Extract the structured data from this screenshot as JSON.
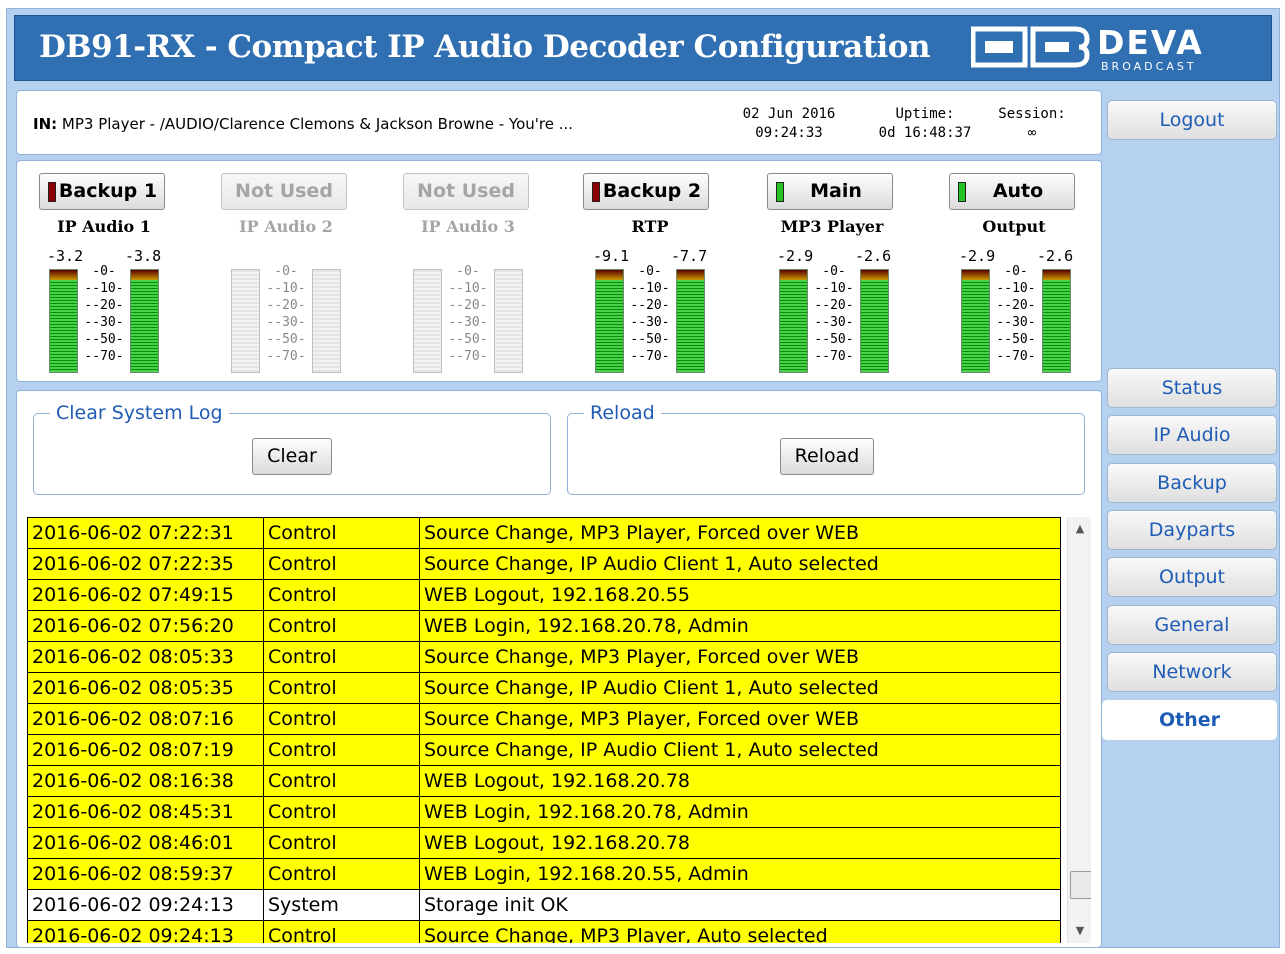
{
  "header": {
    "title": "DB91-RX - Compact IP Audio Decoder Configuration",
    "logo_text": "DEVA",
    "logo_sub": "BROADCAST"
  },
  "info": {
    "in_label": "IN:",
    "in_value": "MP3 Player - /AUDIO/Clarence Clemons & Jackson Browne - You're ...",
    "date": "02 Jun 2016",
    "time": "09:24:33",
    "uptime_label": "Uptime:",
    "uptime_value": "0d 16:48:37",
    "session_label": "Session:",
    "session_value": "∞"
  },
  "sidebar": {
    "logout": "Logout",
    "items": [
      "Status",
      "IP Audio",
      "Backup",
      "Dayparts",
      "Output",
      "General",
      "Network",
      "Other"
    ],
    "active": "Other"
  },
  "sources": [
    {
      "button": "Backup 1",
      "led": "red",
      "label": "IP Audio 1",
      "enabled": true,
      "peak_l": "-3.2",
      "peak_r": "-3.8"
    },
    {
      "button": "Not Used",
      "led": "none",
      "label": "IP Audio 2",
      "enabled": false,
      "peak_l": "",
      "peak_r": ""
    },
    {
      "button": "Not Used",
      "led": "none",
      "label": "IP Audio 3",
      "enabled": false,
      "peak_l": "",
      "peak_r": ""
    },
    {
      "button": "Backup 2",
      "led": "red",
      "label": "RTP",
      "enabled": true,
      "peak_l": "-9.1",
      "peak_r": "-7.7"
    },
    {
      "button": "Main",
      "led": "green",
      "label": "MP3 Player",
      "enabled": true,
      "peak_l": "-2.9",
      "peak_r": "-2.6"
    },
    {
      "button": "Auto",
      "led": "green",
      "label": "Output",
      "enabled": true,
      "peak_l": "-2.9",
      "peak_r": "-2.6"
    }
  ],
  "meter_scale": [
    "0",
    "-10",
    "-20",
    "-30",
    "-50",
    "-70"
  ],
  "clear_log": {
    "legend": "Clear System Log",
    "button": "Clear"
  },
  "reload": {
    "legend": "Reload",
    "button": "Reload"
  },
  "log": [
    {
      "time": "2016-06-02 07:22:31",
      "type": "Control",
      "msg": "Source Change, MP3 Player, Forced over WEB"
    },
    {
      "time": "2016-06-02 07:22:35",
      "type": "Control",
      "msg": "Source Change, IP Audio Client 1, Auto selected"
    },
    {
      "time": "2016-06-02 07:49:15",
      "type": "Control",
      "msg": "WEB Logout, 192.168.20.55"
    },
    {
      "time": "2016-06-02 07:56:20",
      "type": "Control",
      "msg": "WEB Login, 192.168.20.78, Admin"
    },
    {
      "time": "2016-06-02 08:05:33",
      "type": "Control",
      "msg": "Source Change, MP3 Player, Forced over WEB"
    },
    {
      "time": "2016-06-02 08:05:35",
      "type": "Control",
      "msg": "Source Change, IP Audio Client 1, Auto selected"
    },
    {
      "time": "2016-06-02 08:07:16",
      "type": "Control",
      "msg": "Source Change, MP3 Player, Forced over WEB"
    },
    {
      "time": "2016-06-02 08:07:19",
      "type": "Control",
      "msg": "Source Change, IP Audio Client 1, Auto selected"
    },
    {
      "time": "2016-06-02 08:16:38",
      "type": "Control",
      "msg": "WEB Logout, 192.168.20.78"
    },
    {
      "time": "2016-06-02 08:45:31",
      "type": "Control",
      "msg": "WEB Login, 192.168.20.78, Admin"
    },
    {
      "time": "2016-06-02 08:46:01",
      "type": "Control",
      "msg": "WEB Logout, 192.168.20.78"
    },
    {
      "time": "2016-06-02 08:59:37",
      "type": "Control",
      "msg": "WEB Login, 192.168.20.55, Admin"
    },
    {
      "time": "2016-06-02 09:24:13",
      "type": "System",
      "msg": "Storage init OK"
    },
    {
      "time": "2016-06-02 09:24:13",
      "type": "Control",
      "msg": "Source Change, MP3 Player, Auto selected"
    }
  ],
  "colors": {
    "header_bg": "#2f6fb2",
    "frame_bg": "#b5d1ef",
    "accent_text": "#1f5cb5",
    "log_control_bg": "#ffff00",
    "log_system_bg": "#ffffff",
    "led_red": "#8b0000",
    "led_green": "#22c322"
  }
}
